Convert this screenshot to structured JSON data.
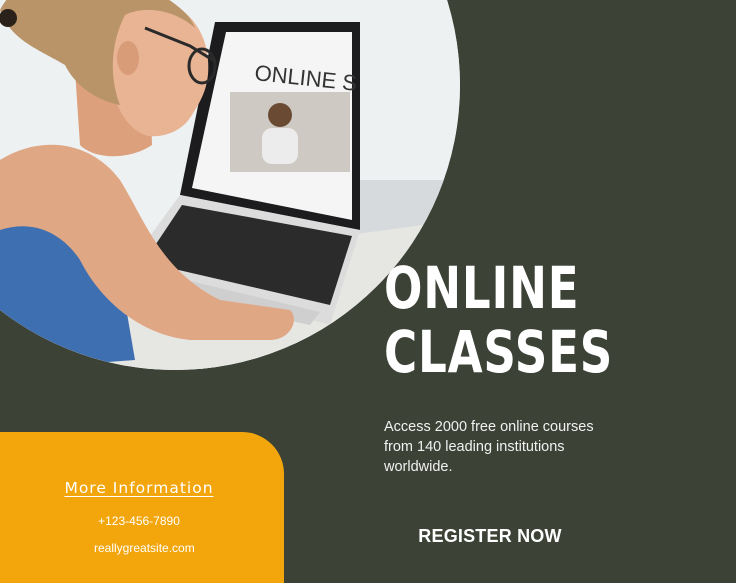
{
  "title": {
    "line1": "ONLINE",
    "line2": "CLASSES"
  },
  "description": {
    "line1": "Access 2000 free online courses",
    "line2": "from 140 leading institutions",
    "line3": "worldwide."
  },
  "cta": {
    "register_label": "REGISTER NOW"
  },
  "info": {
    "heading": "More Information",
    "phone": "+123-456-7890",
    "website": "reallygreatsite.com"
  },
  "photo": {
    "screen_text": "ONLINE S",
    "alt_icon": "photo-woman-laptop"
  },
  "colors": {
    "background": "#3c4236",
    "accent": "#f2a60c",
    "text": "#ffffff"
  }
}
